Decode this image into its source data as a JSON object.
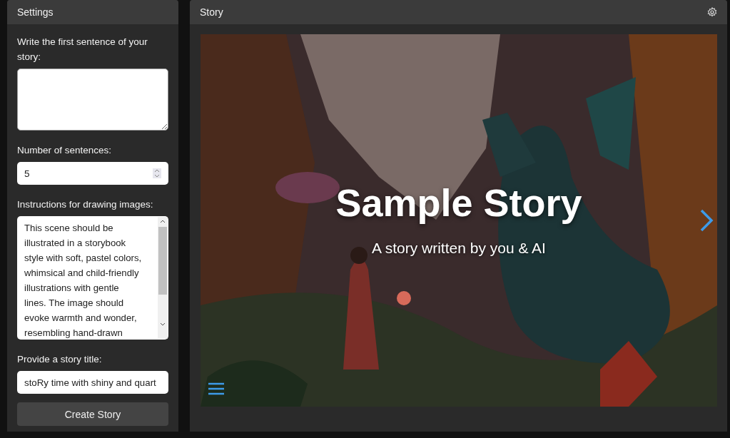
{
  "settings": {
    "title": "Settings",
    "first_sentence": {
      "label": "Write the first sentence of your story:"
    },
    "sentences": {
      "label": "Number of sentences:",
      "value": "5"
    },
    "instructions": {
      "label": "Instructions for drawing images:",
      "value": "This scene should be illustrated in a storybook style with soft, pastel colors, whimsical and child-friendly illustrations with gentle lines. The image should evoke warmth and wonder, resembling hand-drawn"
    },
    "story_title": {
      "label": "Provide a story title:",
      "value": "stoRy time with shiny and quart"
    },
    "button": "Create Story"
  },
  "story": {
    "title": "Story",
    "slide": {
      "kind": "picture",
      "heading": "Sample Story",
      "subheading": "A story written by you & AI"
    }
  }
}
